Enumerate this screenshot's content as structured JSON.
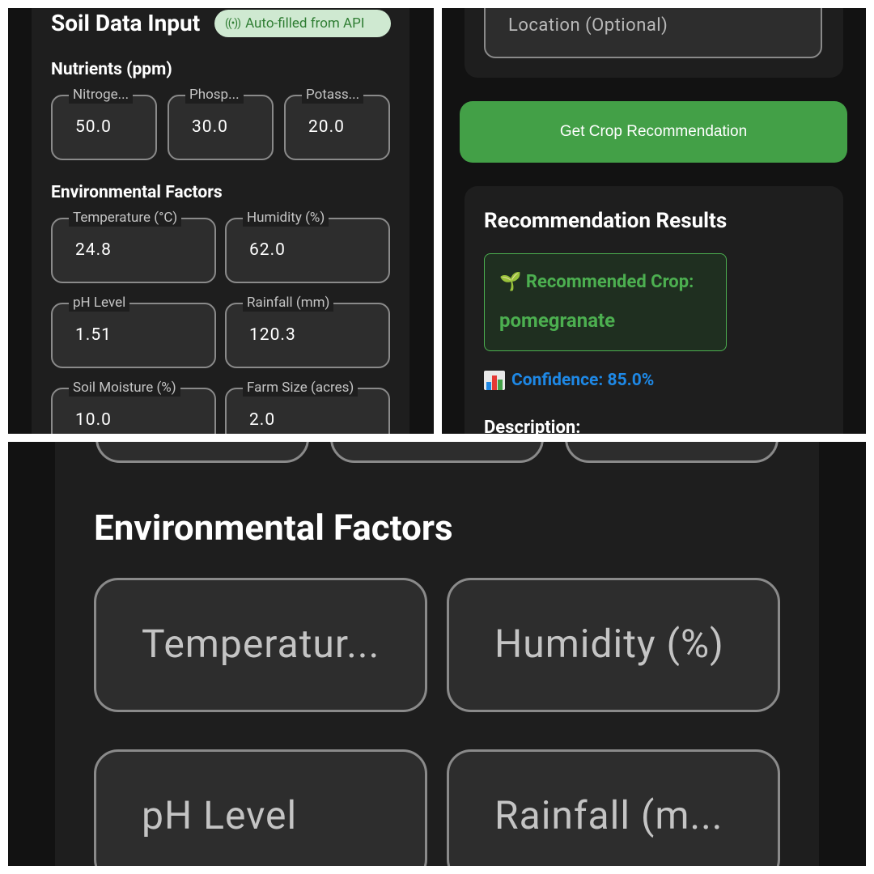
{
  "panel1": {
    "title": "Soil Data Input",
    "badge": {
      "icon": "broadcast-icon",
      "text": "Auto-filled from API"
    },
    "nutrients": {
      "heading": "Nutrients (ppm)",
      "fields": [
        {
          "label": "Nitroge...",
          "value": "50.0"
        },
        {
          "label": "Phosp...",
          "value": "30.0"
        },
        {
          "label": "Potass...",
          "value": "20.0"
        }
      ]
    },
    "environment": {
      "heading": "Environmental Factors",
      "fields": [
        {
          "label": "Temperature (°C)",
          "value": "24.8"
        },
        {
          "label": "Humidity (%)",
          "value": "62.0"
        },
        {
          "label": "pH Level",
          "value": "1.51"
        },
        {
          "label": "Rainfall (mm)",
          "value": "120.3"
        },
        {
          "label": "Soil Moisture (%)",
          "value": "10.0"
        },
        {
          "label": "Farm Size (acres)",
          "value": "2.0"
        }
      ]
    }
  },
  "panel2": {
    "location_placeholder": "Location (Optional)",
    "button_label": "Get Crop Recommendation",
    "results": {
      "title": "Recommendation Results",
      "crop_icon": "🌱",
      "crop_label": "Recommended Crop:",
      "crop_value": "pomegranate",
      "confidence_icon": "bar-chart-icon",
      "confidence_text": "Confidence: 85.0%",
      "description_heading": "Description:"
    }
  },
  "panel3": {
    "heading": "Environmental Factors",
    "fields": [
      {
        "label": "Temperatur..."
      },
      {
        "label": "Humidity (%)"
      },
      {
        "label": "pH Level"
      },
      {
        "label": "Rainfall (m..."
      }
    ]
  },
  "colors": {
    "background": "#121212",
    "card": "#1e1e1e",
    "field": "#2d2d2d",
    "accent_green": "#43a047",
    "crop_green": "#4caf50",
    "confidence_blue": "#1e88e5",
    "badge_bg": "#cfe9d1"
  }
}
